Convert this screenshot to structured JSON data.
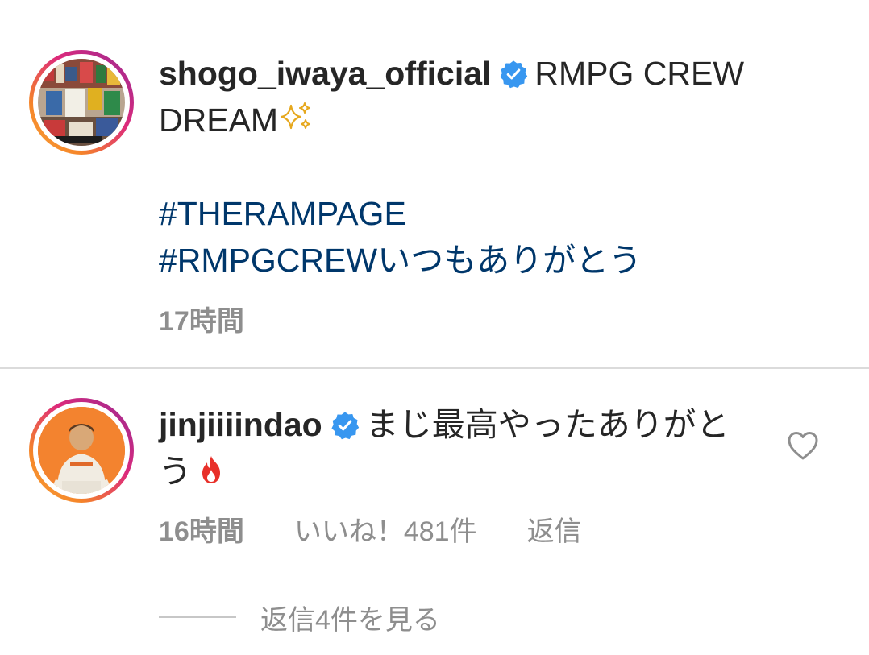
{
  "post": {
    "author": "shogo_iwaya_official",
    "verified": true,
    "caption": "RMPG CREW DREAM",
    "caption_emoji": "sparkles-icon",
    "hashtags": [
      "#THERAMPAGE",
      "#RMPGCREWいつもありがとう"
    ],
    "time": "17時間"
  },
  "comment": {
    "author": "jinjiiiindao",
    "verified": true,
    "text": "まじ最高やったありがとう",
    "emoji": "fire-icon",
    "time": "16時間",
    "likes": "いいね！481件",
    "reply_label": "返信",
    "view_replies_label": "返信4件を見る"
  },
  "colors": {
    "hashtag": "#00376b",
    "secondary_text": "#8e8e8e",
    "verified_badge": "#3897f0",
    "story_ring_start": "#f9a43b",
    "story_ring_end": "#8134af"
  }
}
